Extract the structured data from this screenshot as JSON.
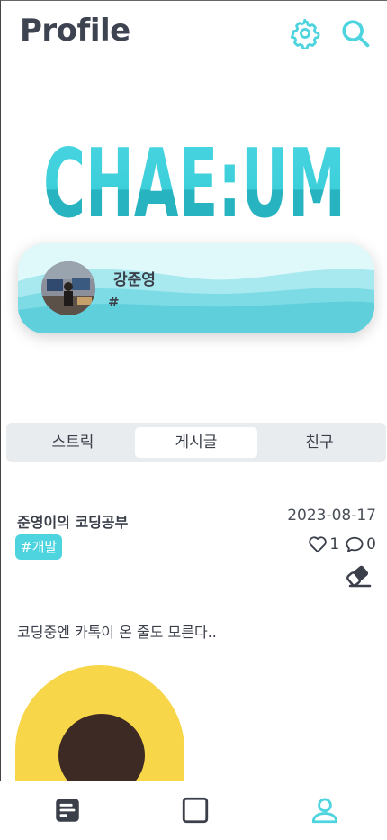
{
  "header": {
    "title": "Profile",
    "settings_icon": "gear-icon",
    "search_icon": "search-icon",
    "accent": "#4dd4df"
  },
  "logo": {
    "text": "CHAE:UM",
    "color": "#3ccfda"
  },
  "profile_card": {
    "name": "강준영",
    "hashtag": "#"
  },
  "tabs": [
    {
      "label": "스트릭",
      "active": false
    },
    {
      "label": "게시글",
      "active": true
    },
    {
      "label": "친구",
      "active": false
    }
  ],
  "post": {
    "title": "준영이의 코딩공부",
    "date": "2023-08-17",
    "tag": "#개발",
    "likes": "1",
    "comments": "0",
    "body": "코딩중엔 카톡이 온 줄도 모른다.."
  },
  "bottom_nav": [
    {
      "name": "posts",
      "icon": "document-icon"
    },
    {
      "name": "home",
      "icon": "square-icon"
    },
    {
      "name": "profile",
      "icon": "person-icon",
      "active": true
    }
  ]
}
